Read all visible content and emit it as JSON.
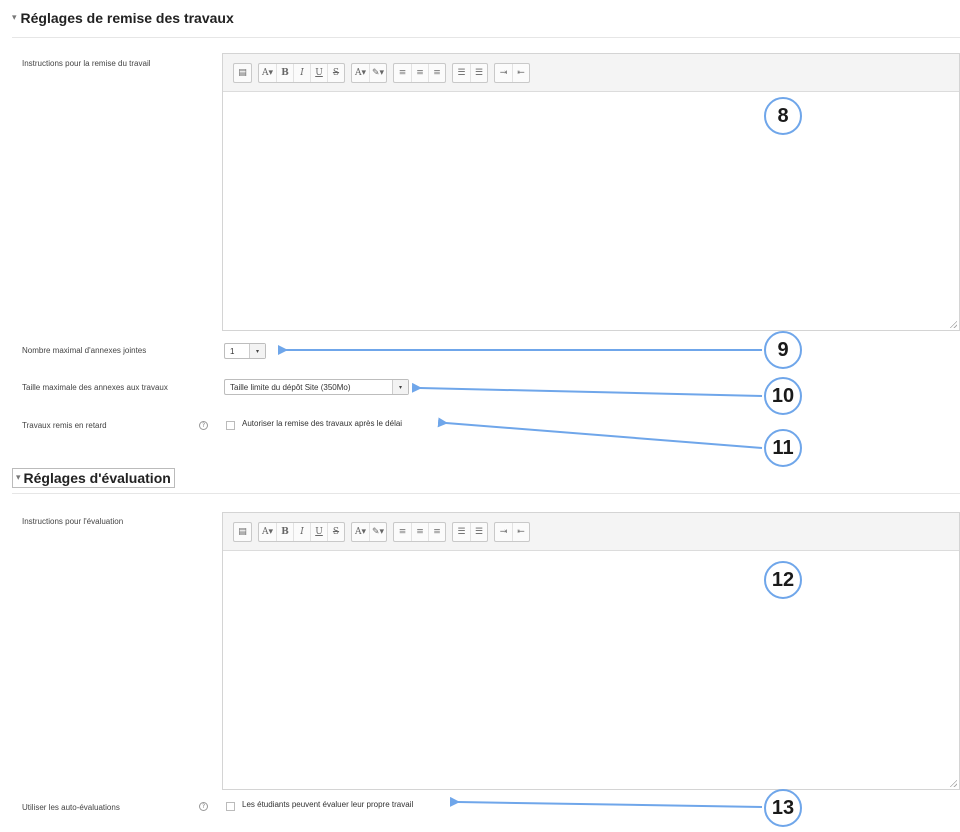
{
  "section1": {
    "title": "Réglages de remise des travaux",
    "instructions_label": "Instructions pour la remise du travail",
    "max_files_label": "Nombre maximal d'annexes jointes",
    "max_files_value": "1",
    "max_size_label": "Taille maximale des annexes aux travaux",
    "max_size_value": "Taille limite du dépôt Site (350Mo)",
    "late_label": "Travaux remis en retard",
    "late_checkbox": "Autoriser la remise des travaux après le délai"
  },
  "section2": {
    "title": "Réglages d'évaluation",
    "instructions_label": "Instructions pour l'évaluation",
    "self_assess_label": "Utiliser les auto-évaluations",
    "self_assess_checkbox": "Les étudiants peuvent évaluer leur propre travail"
  },
  "toolbar": [
    "▤",
    "A▾",
    "B",
    "I",
    "U",
    "S",
    "A▾",
    "✎▾",
    "≡",
    "≡",
    "≡",
    "☰",
    "☰",
    "⇥",
    "⇤"
  ],
  "badges": {
    "b8": "8",
    "b9": "9",
    "b10": "10",
    "b11": "11",
    "b12": "12",
    "b13": "13"
  },
  "colors": {
    "accent": "#6fa6ea"
  }
}
